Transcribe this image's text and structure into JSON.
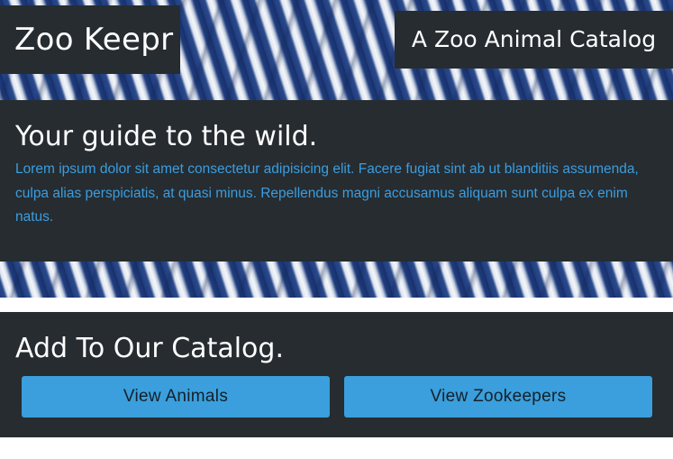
{
  "header": {
    "brand": "Zoo Keepr",
    "tagline": "A Zoo Animal Catalog"
  },
  "intro": {
    "heading": "Your guide to the wild.",
    "body": "Lorem ipsum dolor sit amet consectetur adipisicing elit. Facere fugiat sint ab ut blanditiis assumenda, culpa alias perspiciatis, at quasi minus. Repellendus magni accusamus aliquam sunt culpa ex enim natus."
  },
  "catalog": {
    "heading": "Add To Our Catalog.",
    "buttons": {
      "animals": "View Animals",
      "zookeepers": "View Zookeepers"
    }
  },
  "colors": {
    "panel": "#262c30",
    "accent": "#3a9fdc",
    "body_text": "#3b9de0"
  }
}
